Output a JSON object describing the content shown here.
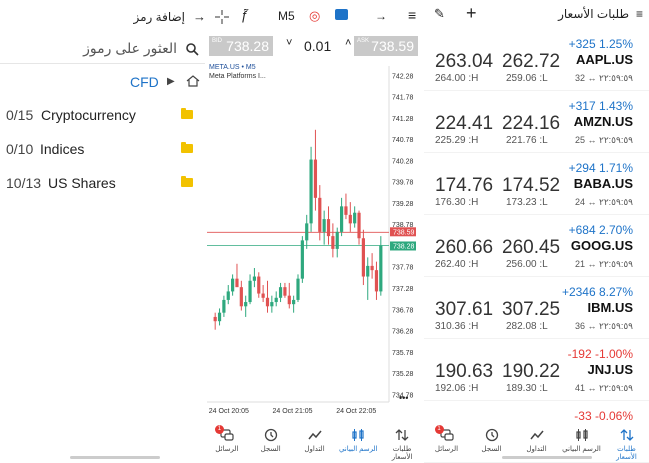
{
  "left": {
    "add_symbol": "إضافة رمز",
    "search_placeholder": "العثور على رموز",
    "path": "CFD",
    "folders": [
      {
        "count": "0/15",
        "name": "Cryptocurrency"
      },
      {
        "count": "0/10",
        "name": "Indices"
      },
      {
        "count": "10/13",
        "name": "US Shares"
      }
    ]
  },
  "mid": {
    "timeframe": "M5",
    "bid_tag": "BID",
    "ask_tag": "ASK",
    "bid": "738.28",
    "ask": "738.59",
    "lot": "0.01",
    "lot_minus": "˅",
    "lot_plus": "˄",
    "symbol": "META.US • M5",
    "description": "Meta Platforms I...",
    "more": "•••"
  },
  "chart_data": {
    "type": "candlestick",
    "title": "META.US • M5",
    "y_ticks": [
      "742.28",
      "741.78",
      "741.28",
      "740.78",
      "740.28",
      "739.78",
      "739.28",
      "738.78",
      "738.28",
      "737.78",
      "737.28",
      "736.78",
      "736.28",
      "735.78",
      "735.28",
      "734.78"
    ],
    "x_ticks": [
      "24 Oct 20:05",
      "24 Oct 21:05",
      "24 Oct 22:05"
    ],
    "ylim": [
      734.6,
      742.5
    ],
    "bid_line": 738.28,
    "ask_line": 738.59,
    "candles": [
      {
        "o": 736.6,
        "h": 736.7,
        "l": 736.3,
        "c": 736.5
      },
      {
        "o": 736.5,
        "h": 736.8,
        "l": 736.4,
        "c": 736.7
      },
      {
        "o": 736.7,
        "h": 737.1,
        "l": 736.6,
        "c": 737.0
      },
      {
        "o": 737.0,
        "h": 737.35,
        "l": 736.9,
        "c": 737.2
      },
      {
        "o": 737.2,
        "h": 737.6,
        "l": 737.1,
        "c": 737.5
      },
      {
        "o": 737.5,
        "h": 737.85,
        "l": 737.4,
        "c": 737.3
      },
      {
        "o": 737.3,
        "h": 737.45,
        "l": 736.75,
        "c": 736.85
      },
      {
        "o": 736.85,
        "h": 737.1,
        "l": 736.6,
        "c": 736.95
      },
      {
        "o": 736.95,
        "h": 737.6,
        "l": 736.9,
        "c": 737.45
      },
      {
        "o": 737.45,
        "h": 737.75,
        "l": 737.3,
        "c": 737.55
      },
      {
        "o": 737.55,
        "h": 737.65,
        "l": 737.05,
        "c": 737.15
      },
      {
        "o": 737.15,
        "h": 737.35,
        "l": 736.95,
        "c": 737.05
      },
      {
        "o": 737.05,
        "h": 737.45,
        "l": 736.7,
        "c": 736.85
      },
      {
        "o": 736.85,
        "h": 737.1,
        "l": 736.7,
        "c": 736.95
      },
      {
        "o": 736.95,
        "h": 737.2,
        "l": 736.85,
        "c": 737.05
      },
      {
        "o": 737.05,
        "h": 737.4,
        "l": 736.95,
        "c": 737.3
      },
      {
        "o": 737.3,
        "h": 737.4,
        "l": 737.05,
        "c": 737.1
      },
      {
        "o": 737.1,
        "h": 737.4,
        "l": 736.8,
        "c": 736.9
      },
      {
        "o": 736.9,
        "h": 737.1,
        "l": 736.7,
        "c": 737.0
      },
      {
        "o": 737.0,
        "h": 737.6,
        "l": 736.95,
        "c": 737.5
      },
      {
        "o": 737.5,
        "h": 738.5,
        "l": 737.4,
        "c": 738.4
      },
      {
        "o": 738.4,
        "h": 739.0,
        "l": 738.2,
        "c": 738.8
      },
      {
        "o": 738.8,
        "h": 740.6,
        "l": 738.6,
        "c": 740.3
      },
      {
        "o": 740.3,
        "h": 741.0,
        "l": 739.1,
        "c": 739.4
      },
      {
        "o": 739.4,
        "h": 739.7,
        "l": 738.4,
        "c": 738.6
      },
      {
        "o": 738.6,
        "h": 739.1,
        "l": 738.3,
        "c": 738.9
      },
      {
        "o": 738.9,
        "h": 739.2,
        "l": 738.3,
        "c": 738.5
      },
      {
        "o": 738.5,
        "h": 738.8,
        "l": 738.0,
        "c": 738.2
      },
      {
        "o": 738.2,
        "h": 738.7,
        "l": 738.0,
        "c": 738.6
      },
      {
        "o": 738.6,
        "h": 739.4,
        "l": 738.5,
        "c": 739.2
      },
      {
        "o": 739.2,
        "h": 739.5,
        "l": 738.9,
        "c": 739.0
      },
      {
        "o": 739.0,
        "h": 739.3,
        "l": 738.6,
        "c": 738.8
      },
      {
        "o": 738.8,
        "h": 739.2,
        "l": 738.7,
        "c": 739.05
      },
      {
        "o": 739.05,
        "h": 739.1,
        "l": 738.3,
        "c": 738.45
      },
      {
        "o": 738.45,
        "h": 738.65,
        "l": 737.35,
        "c": 737.55
      },
      {
        "o": 737.55,
        "h": 738.0,
        "l": 737.0,
        "c": 737.8
      },
      {
        "o": 737.8,
        "h": 738.1,
        "l": 737.5,
        "c": 737.7
      },
      {
        "o": 737.7,
        "h": 737.9,
        "l": 737.0,
        "c": 737.2
      },
      {
        "o": 737.2,
        "h": 738.5,
        "l": 737.1,
        "c": 738.28
      }
    ],
    "up_color": "#2ea87e",
    "down_color": "#e05252"
  },
  "nav": [
    {
      "label": "طلبات الأسعار",
      "icon": "quotes-icon"
    },
    {
      "label": "الرسم البياني",
      "icon": "chart-icon"
    },
    {
      "label": "التداول",
      "icon": "trade-icon"
    },
    {
      "label": "السجل",
      "icon": "history-icon"
    },
    {
      "label": "الرسائل",
      "icon": "messages-icon",
      "badge": "1"
    }
  ],
  "right": {
    "title": "طلبات الأسعار",
    "quotes": [
      {
        "symbol": "AAPL.US",
        "change": "+325 1.25%",
        "dir": "pos",
        "bid": "263.04",
        "ask": "262.72",
        "high": "264.00 :H",
        "low": "259.06 :L",
        "meta": "32 ↔ ٢٢:٥٩:٥٩"
      },
      {
        "symbol": "AMZN.US",
        "change": "+317 1.43%",
        "dir": "pos",
        "bid": "224.41",
        "ask": "224.16",
        "high": "225.29 :H",
        "low": "221.76 :L",
        "meta": "25 ↔ ٢٢:٥٩:٥٩"
      },
      {
        "symbol": "BABA.US",
        "change": "+294 1.71%",
        "dir": "pos",
        "bid": "174.76",
        "ask": "174.52",
        "high": "176.30 :H",
        "low": "173.23 :L",
        "meta": "24 ↔ ٢٢:٥٩:٥٩"
      },
      {
        "symbol": "GOOG.US",
        "change": "+684 2.70%",
        "dir": "pos",
        "bid": "260.66",
        "ask": "260.45",
        "high": "262.40 :H",
        "low": "256.00 :L",
        "meta": "21 ↔ ٢٢:٥٩:٥٩"
      },
      {
        "symbol": "IBM.US",
        "change": "+2346 8.27%",
        "dir": "pos",
        "bid": "307.61",
        "ask": "307.25",
        "high": "310.36 :H",
        "low": "282.08 :L",
        "meta": "36 ↔ ٢٢:٥٩:٥٩"
      },
      {
        "symbol": "JNJ.US",
        "change": "-192 -1.00%",
        "dir": "neg",
        "bid": "190.63",
        "ask": "190.22",
        "high": "192.06 :H",
        "low": "189.30 :L",
        "meta": "41 ↔ ٢٢:٥٩:٥٩"
      },
      {
        "symbol": "",
        "change": "-33 -0.06%",
        "dir": "neg",
        "bid": "",
        "ask": "",
        "high": "",
        "low": "",
        "meta": ""
      }
    ]
  },
  "colors": {
    "accent": "#1e73c8",
    "negative": "#e53935",
    "bidbox": "#c9c9c9",
    "bidline": "#e05252",
    "askline": "#2ea87e"
  }
}
